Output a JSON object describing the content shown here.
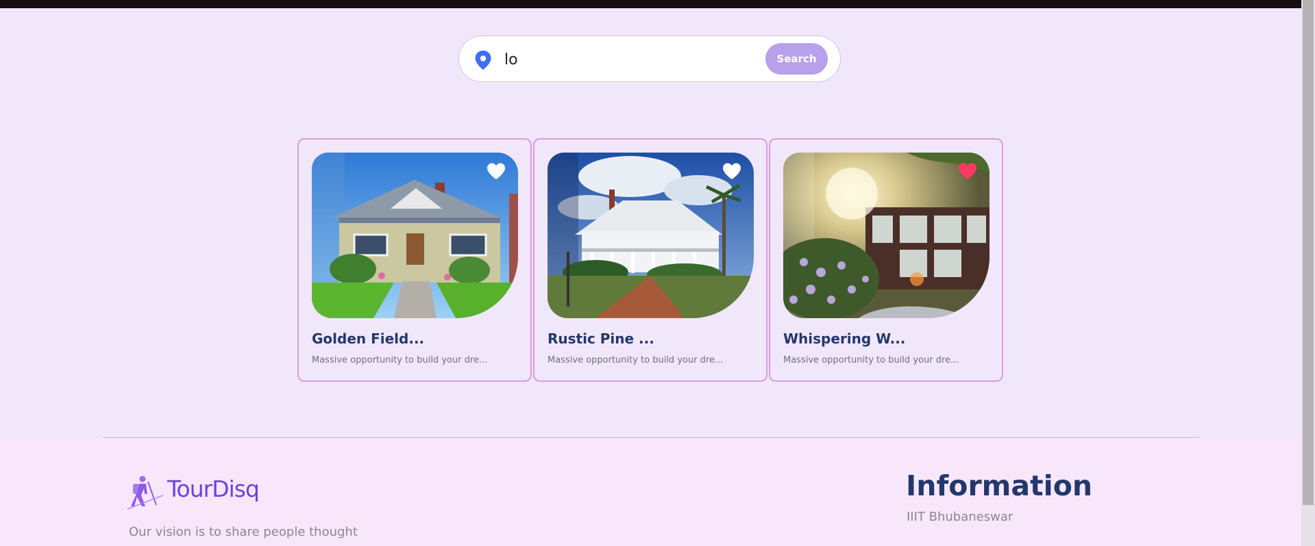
{
  "search": {
    "value": "lo",
    "button_label": "Search",
    "icon": "location-pin-icon"
  },
  "cards": [
    {
      "title": "Golden Field...",
      "description": "Massive opportunity to build your dre...",
      "favorited": false,
      "image": "suburban-house-photo"
    },
    {
      "title": "Rustic Pine ...",
      "description": "Massive opportunity to build your dre...",
      "favorited": false,
      "image": "victorian-mansion-photo"
    },
    {
      "title": "Whispering W...",
      "description": "Massive opportunity to build your dre...",
      "favorited": true,
      "image": "modern-house-sunlight-photo"
    }
  ],
  "footer": {
    "brand": "TourDisq",
    "vision": "Our vision is to share people thought",
    "info_heading": "Information",
    "info_address": "IIIT Bhubaneswar"
  },
  "colors": {
    "accent": "#b8a0ea",
    "brand": "#6f3fe0",
    "heading": "#22386b",
    "card_border": "#d99ae6",
    "heart_active": "#ff3b63",
    "page_bg": "#f1e7fa"
  }
}
